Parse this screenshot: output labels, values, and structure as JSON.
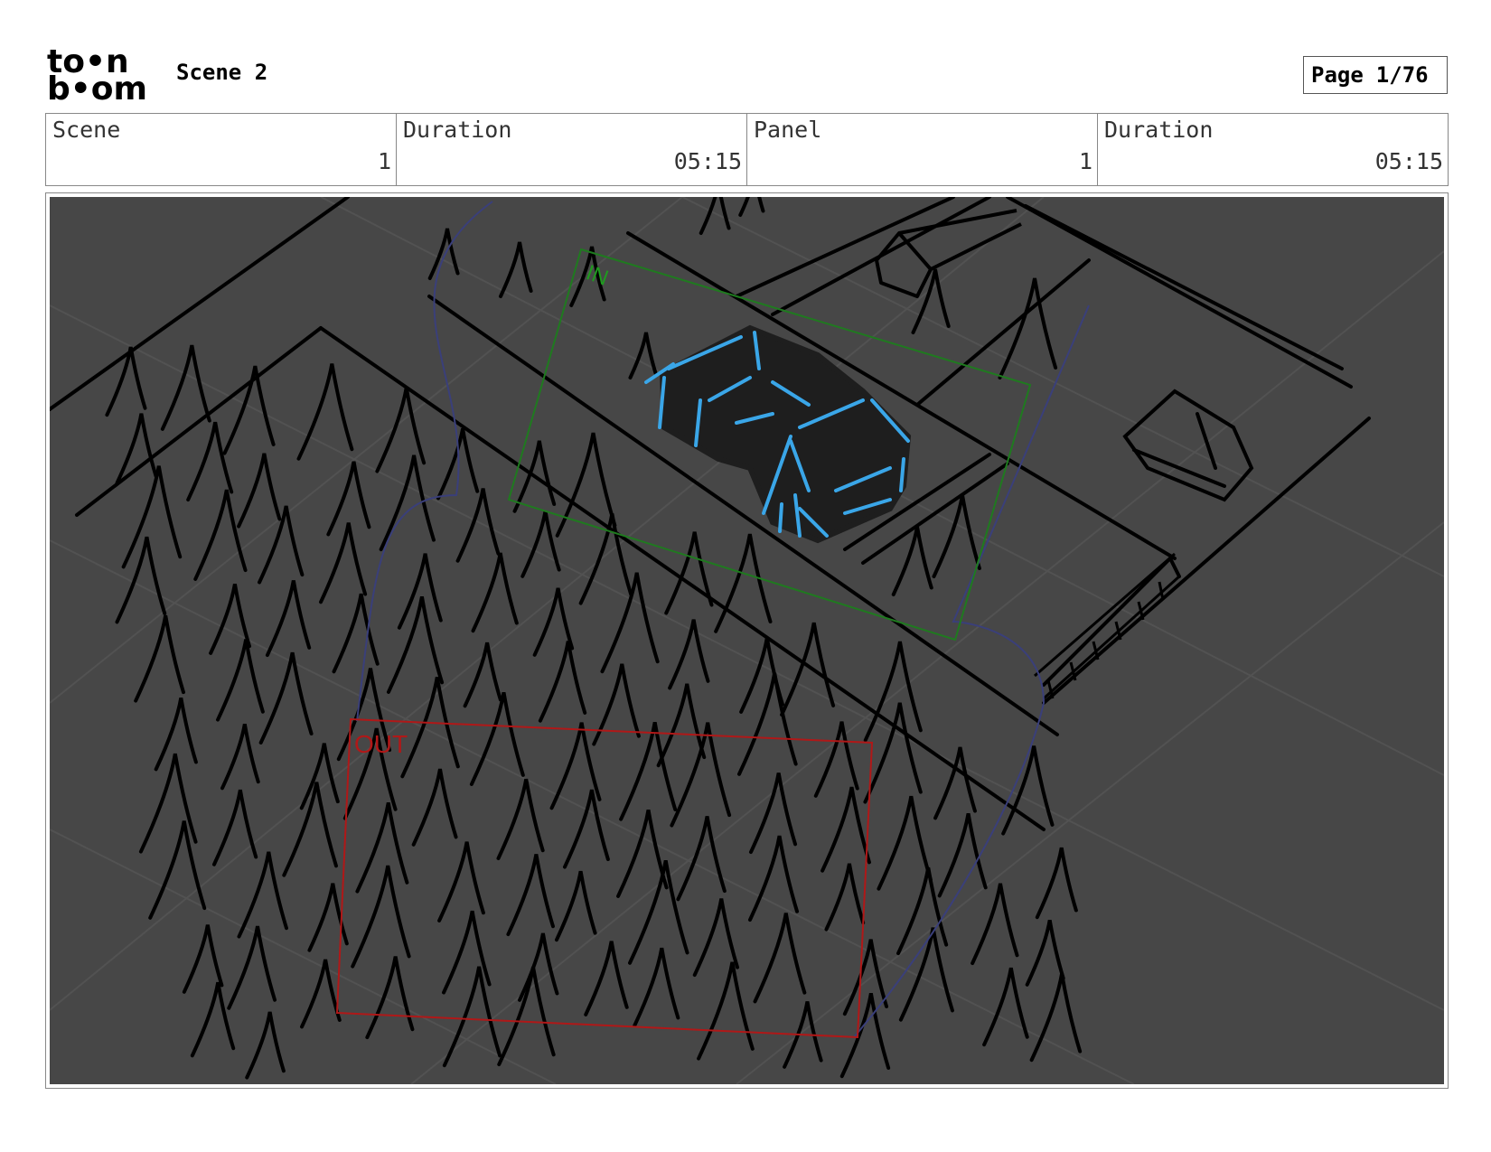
{
  "header": {
    "logo_line1": "to•n",
    "logo_line2": "b•om",
    "scene_title": "Scene 2",
    "page_label": "Page",
    "page_number": "1/76"
  },
  "info": {
    "scene_label": "Scene",
    "scene_value": "1",
    "duration_label": "Duration",
    "duration_value": "05:15",
    "panel_label": "Panel",
    "panel_value": "1",
    "panel_duration_label": "Duration",
    "panel_duration_value": "05:15"
  },
  "panel": {
    "in_label": "IN",
    "out_label": "OUT",
    "colors": {
      "background": "#474747",
      "ink": "#000000",
      "car_fill": "#1e1e1e",
      "car_lines": "#3aa6e8",
      "in_frame": "#1f7a1f",
      "out_frame": "#b01818",
      "camera_path": "#3a3f7a"
    }
  }
}
